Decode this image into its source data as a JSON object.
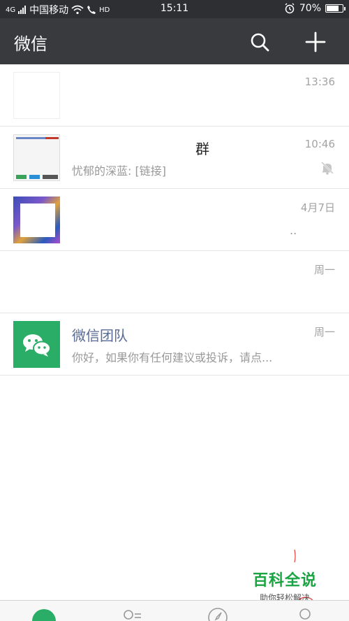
{
  "status_bar": {
    "carrier": "中国移动",
    "signal_label": "4G",
    "hd_label": "HD",
    "time": "15:11",
    "battery": "70%"
  },
  "header": {
    "title": "微信",
    "search_icon": "search-icon",
    "add_icon": "plus-icon"
  },
  "chats": [
    {
      "name": "",
      "preview": "",
      "time": "13:36"
    },
    {
      "name": "群",
      "preview": "忧郁的深蓝: [链接]",
      "time": "10:46",
      "muted": true
    },
    {
      "name": "",
      "preview": "..",
      "time": "4月7日"
    },
    {
      "name": "",
      "preview": "",
      "time": "周一"
    },
    {
      "name": "微信团队",
      "preview": "你好，如果你有任何建议或投诉，请点...",
      "time": "周一"
    }
  ],
  "watermark": {
    "title": "百科全说",
    "subtitle": "助你轻松解决"
  },
  "colors": {
    "header_bg": "#393a3e",
    "status_bg": "#2e2f33",
    "wechat_green": "#2aae67",
    "name_blue": "#576b95"
  }
}
